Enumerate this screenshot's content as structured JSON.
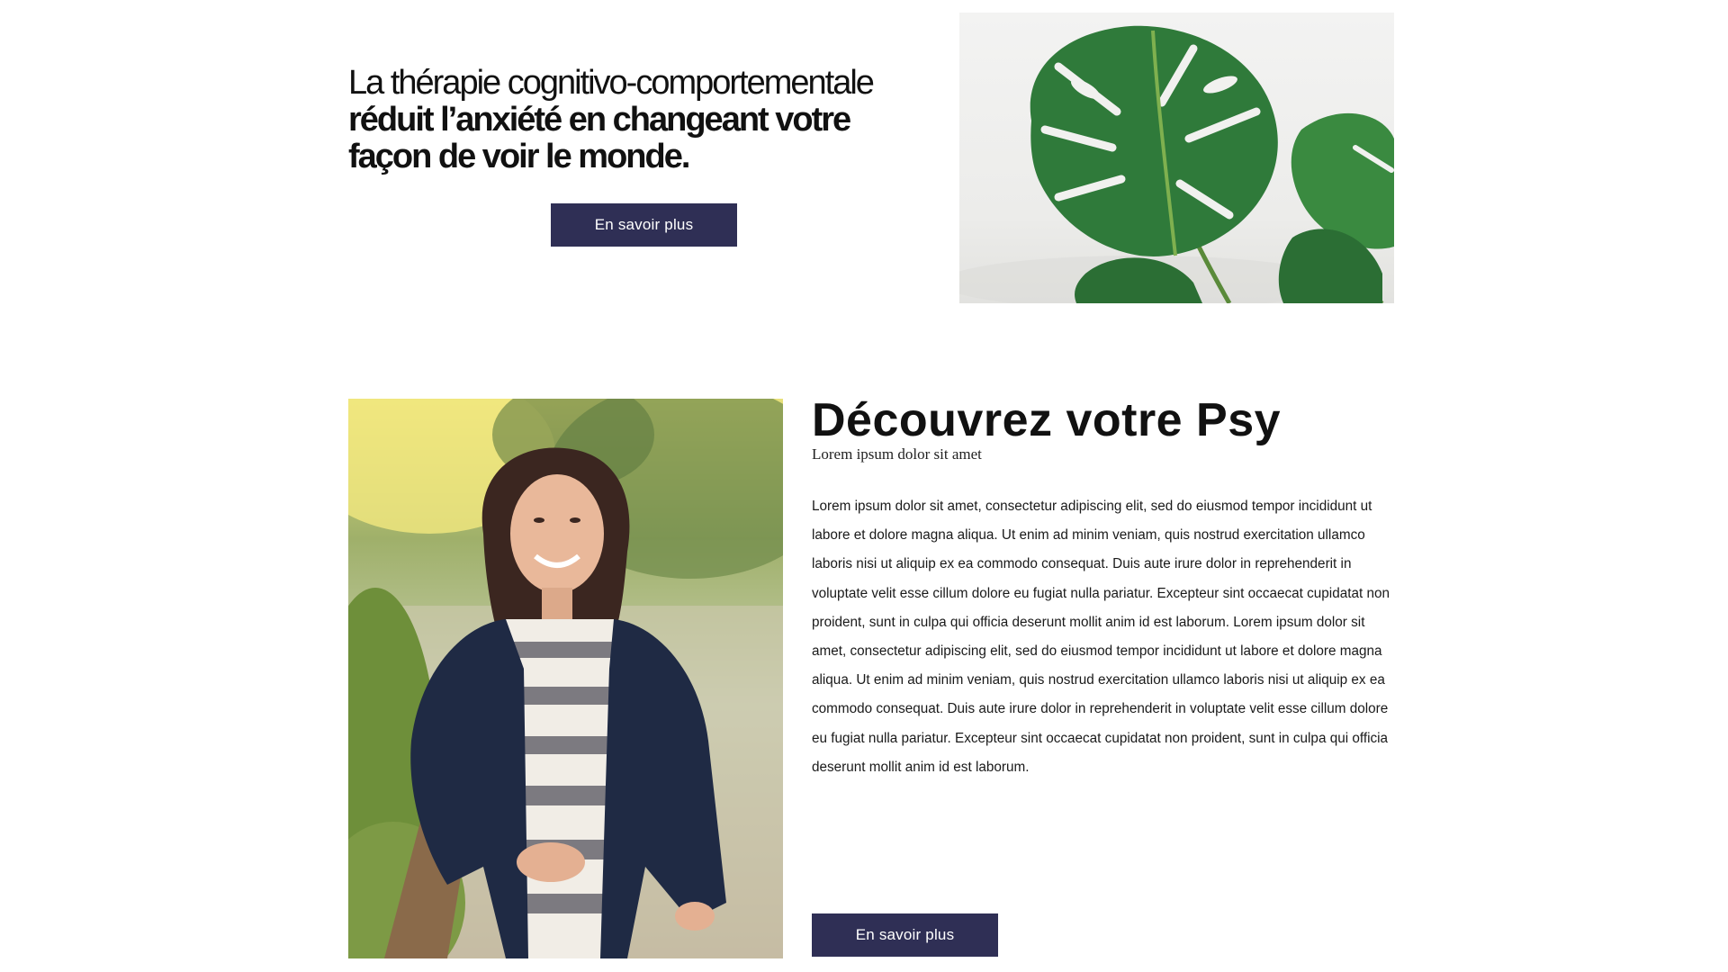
{
  "hero": {
    "heading_light": "La thérapie cognitivo-comportementale",
    "heading_bold": "réduit l’anxiété en changeant votre façon de voir le monde.",
    "button_label": "En savoir plus",
    "image_subject": "monstera-plant"
  },
  "about": {
    "title": "Découvrez votre Psy",
    "subtitle": "Lorem ipsum dolor sit amet",
    "body": "Lorem ipsum dolor sit amet, consectetur adipiscing elit, sed do eiusmod tempor incididunt ut labore et dolore magna aliqua. Ut enim ad minim veniam, quis nostrud exercitation ullamco laboris nisi ut aliquip ex ea commodo consequat. Duis aute irure dolor in reprehenderit in voluptate velit esse cillum dolore eu fugiat nulla pariatur. Excepteur sint occaecat cupidatat non proident, sunt in culpa qui officia deserunt mollit anim id est laborum. Lorem ipsum dolor sit amet, consectetur adipiscing elit, sed do eiusmod tempor incididunt ut labore et dolore magna aliqua. Ut enim ad minim veniam, quis nostrud exercitation ullamco laboris nisi ut aliquip ex ea commodo consequat. Duis aute irure dolor in reprehenderit in voluptate velit esse cillum dolore eu fugiat nulla pariatur. Excepteur sint occaecat cupidatat non proident, sunt in culpa qui officia deserunt mollit anim id est laborum.",
    "button_label": "En savoir plus",
    "image_subject": "therapist-portrait"
  },
  "colors": {
    "button_background": "#2f2f55",
    "button_text": "#ffffff",
    "heading_text": "#111111",
    "page_background": "#ffffff"
  }
}
